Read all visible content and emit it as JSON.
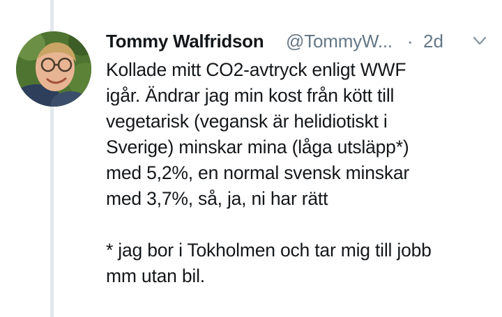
{
  "tweet": {
    "author_name": "Tommy Walfridson",
    "author_handle": "@TommyW...",
    "separator": "·",
    "time": "2d",
    "menu_icon": "chevron-down-icon",
    "avatar_icon": "avatar",
    "text": "Kollade mitt CO2-avtryck enligt WWF\nigår. Ändrar jag min kost från kött till\nvegetarisk (vegansk är helidiotiskt i\nSverige) minskar mina (låga utsläpp*)\nmed 5,2%, en normal svensk minskar\nmed 3,7%, så, ja, ni har rätt\n\n* jag bor i Tokholmen och tar mig till jobb\nmm utan bil."
  },
  "colors": {
    "text": "#14171a",
    "secondary": "#657786",
    "thread_line": "#e1e8ed"
  }
}
